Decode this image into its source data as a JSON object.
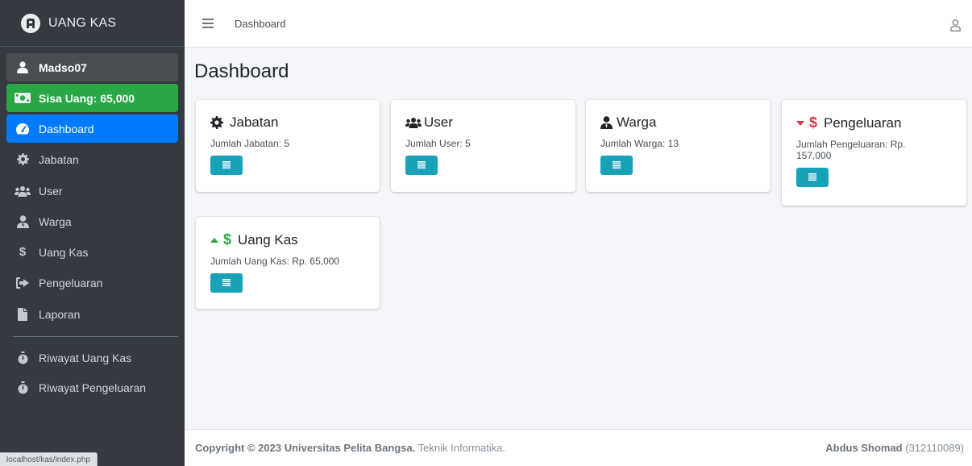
{
  "brand": {
    "title": "UANG KAS"
  },
  "sidebar": {
    "user_label": "Madso07",
    "balance_label": "Sisa Uang: 65,000",
    "items": [
      {
        "label": "Dashboard",
        "icon": "dashboard-icon"
      },
      {
        "label": "Jabatan",
        "icon": "gear-icon"
      },
      {
        "label": "User",
        "icon": "users-icon"
      },
      {
        "label": "Warga",
        "icon": "user-tie-icon"
      },
      {
        "label": "Uang Kas",
        "icon": "dollar-icon"
      },
      {
        "label": "Pengeluaran",
        "icon": "sign-out-icon"
      },
      {
        "label": "Laporan",
        "icon": "file-icon"
      },
      {
        "label": "Riwayat Uang Kas",
        "icon": "stopwatch-icon"
      },
      {
        "label": "Riwayat Pengeluaran",
        "icon": "stopwatch-icon"
      }
    ],
    "status_url": "localhost/kas/index.php"
  },
  "navbar": {
    "title": "Dashboard"
  },
  "page": {
    "title": "Dashboard"
  },
  "cards": [
    {
      "title": "Jabatan",
      "text": "Jumlah Jabatan: 5"
    },
    {
      "title": "User",
      "text": "Jumlah User: 5"
    },
    {
      "title": "Warga",
      "text": "Jumlah Warga: 13"
    },
    {
      "title": "Pengeluaran",
      "text": "Jumlah Pengeluaran: Rp. 157,000"
    },
    {
      "title": "Uang Kas",
      "text": "Jumlah Uang Kas: Rp. 65,000"
    }
  ],
  "footer": {
    "copyright_prefix": "Copyright © 2023 Universitas Pelita Bangsa.",
    "copyright_suffix": " Teknik Informatika.",
    "author_name": "Abdus Shomad",
    "author_id": " (312110089)"
  },
  "colors": {
    "sidebar_bg": "#343a40",
    "active": "#007bff",
    "balance": "#28a745",
    "button": "#17a2b8",
    "up": "#28a745",
    "down": "#dc3545"
  }
}
